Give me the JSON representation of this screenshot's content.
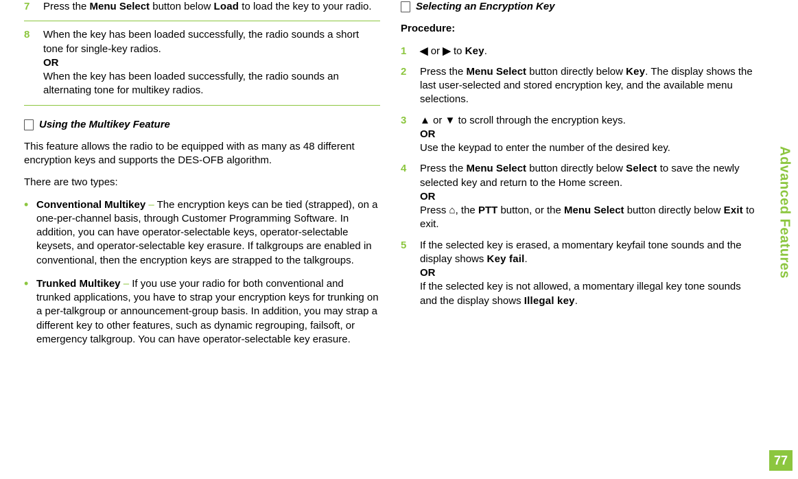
{
  "left": {
    "step7": {
      "num": "7",
      "t1": "Press the ",
      "bold1": "Menu Select",
      "t2": " button below ",
      "mono1": "Load",
      "t3": " to load the key to your radio."
    },
    "step8": {
      "num": "8",
      "line1": "When the key has been loaded successfully, the radio sounds a short tone for single-key radios.",
      "or": "OR",
      "line2": "When the key has been loaded successfully, the radio sounds an alternating tone for multikey radios."
    },
    "section1_title": "Using the Multikey Feature",
    "para1": "This feature allows the radio to be equipped with as many as 48 different encryption keys and supports the DES-OFB algorithm.",
    "para2": "There are two types:",
    "bullet1": {
      "title": "Conventional Multikey",
      "dash": " – ",
      "body": "The encryption keys can be tied (strapped), on a one-per-channel basis, through Customer Programming Software. In addition, you can have operator-selectable keys, operator-selectable keysets, and operator-selectable key erasure. If talkgroups are enabled in conventional, then the encryption keys are strapped to the talkgroups."
    },
    "bullet2": {
      "title": "Trunked Multikey",
      "dash": " – ",
      "body": "If you use your radio for both conventional and trunked applications, you have to strap your encryption keys for trunking on a per-talkgroup or announcement-group basis. In addition, you may strap a different key to other features, such as dynamic regrouping, failsoft, or emergency talkgroup. You can have operator-selectable key erasure."
    }
  },
  "right": {
    "section2_title": "Selecting an Encryption Key",
    "procedure": "Procedure:",
    "step1": {
      "num": "1",
      "arrow_l": "◀",
      "or": " or ",
      "arrow_r": "▶",
      "to": " to ",
      "key": "Key",
      "dot": "."
    },
    "step2": {
      "num": "2",
      "t1": "Press the ",
      "bold1": "Menu Select",
      "t2": " button directly below ",
      "mono1": "Key",
      "t3": ". The display shows the last user-selected and stored encryption key, and the available menu selections."
    },
    "step3": {
      "num": "3",
      "up": "▲",
      "or1": " or ",
      "down": "▼",
      "t1": " to scroll through the encryption keys.",
      "or2": "OR",
      "t2": "Use the keypad to enter the number of the desired key."
    },
    "step4": {
      "num": "4",
      "t1": "Press the ",
      "bold1": "Menu Select",
      "t2": " button directly below ",
      "mono1": "Select",
      "t3": " to save the newly selected key and return to the Home screen.",
      "or": "OR",
      "t4": "Press ",
      "t5": ", the ",
      "bold2": "PTT",
      "t6": " button, or the ",
      "bold3": "Menu Select",
      "t7": " button directly below ",
      "mono2": "Exit",
      "t8": " to exit."
    },
    "step5": {
      "num": "5",
      "t1": "If the selected key is erased, a momentary keyfail tone sounds and the display shows ",
      "mono1": "Key fail",
      "t2": ".",
      "or": "OR",
      "t3": "If the selected key is not allowed, a momentary illegal key tone sounds and the display shows ",
      "mono2": "Illegal key",
      "t4": "."
    }
  },
  "sidebar": "Advanced Features",
  "page_num": "77"
}
